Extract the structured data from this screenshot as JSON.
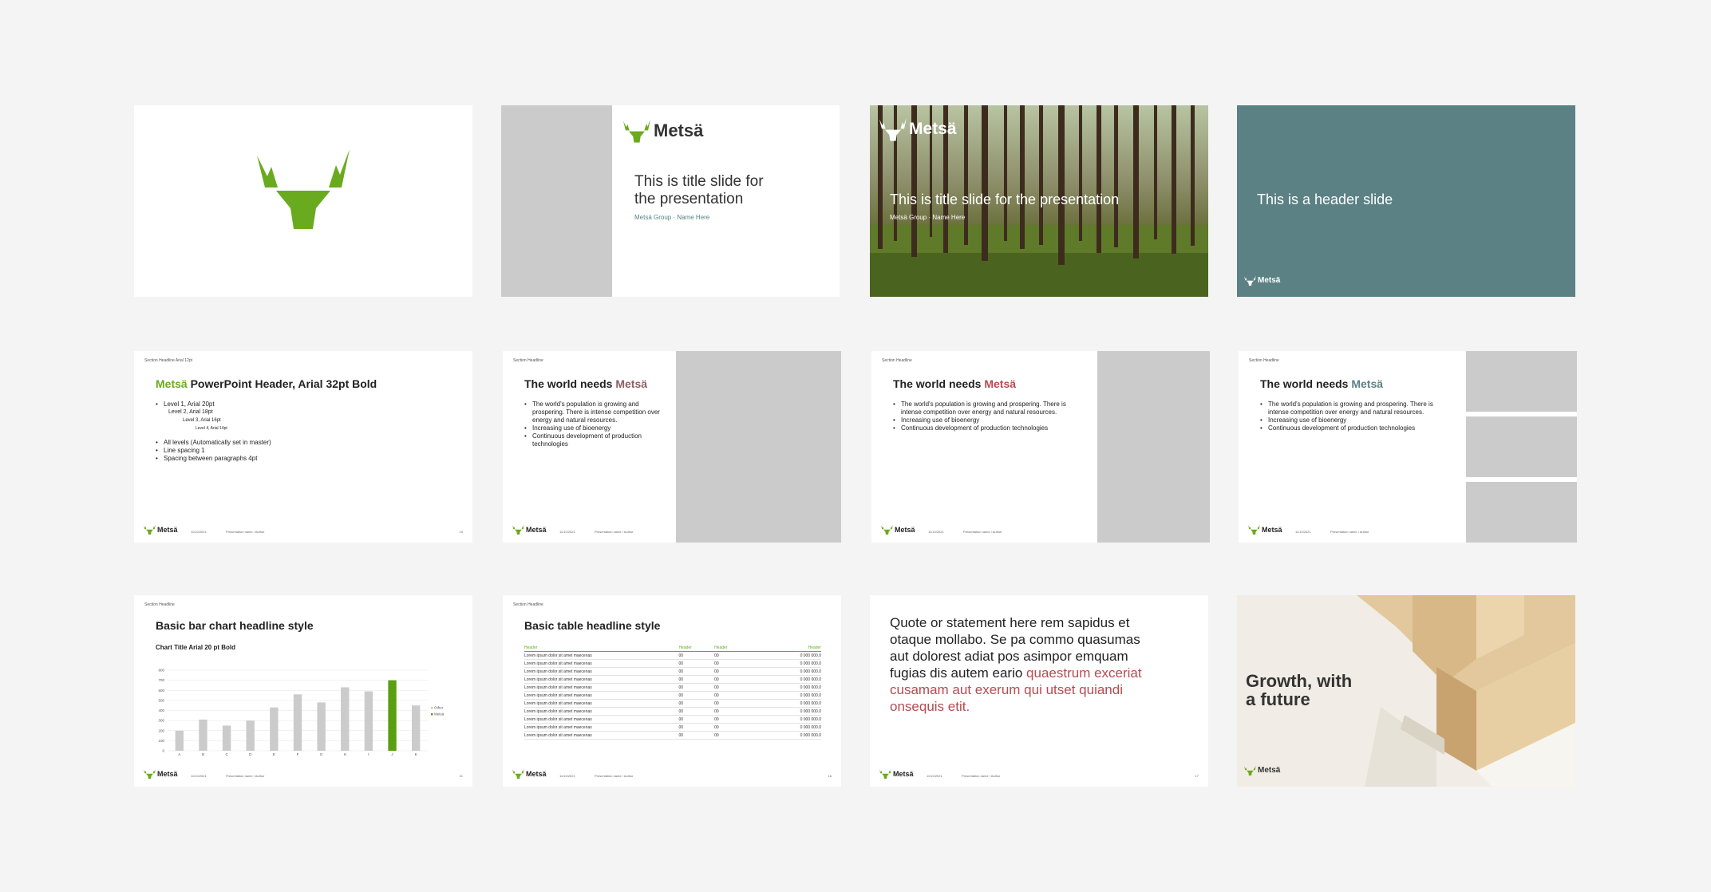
{
  "brand": {
    "name": "Metsä",
    "green": "#6aaa1e",
    "red": "#b64b50",
    "teal": "#5b8185",
    "grey": "#cbcbcb"
  },
  "footer": {
    "date": "11/10/2021",
    "presentation": "Presentation name / Author"
  },
  "slide2": {
    "title_l1": "This is title slide for",
    "title_l2": "the presentation",
    "subtitle": "Metsä Group · Name Here"
  },
  "slide3": {
    "title": "This is title slide for the presentation",
    "subtitle": "Metsä Group · Name Here"
  },
  "slide4": {
    "title": "This is a header slide"
  },
  "slide5": {
    "section": "Section Headline Arial 12pt",
    "header_brand": "Metsä",
    "header_rest": " PowerPoint Header, Arial 32pt Bold",
    "level1": "Level 1, Arial 20pt",
    "level2": "Level 2, Arial 18pt",
    "level3": "Level 3, Arial 16pt",
    "level4": "Level 4, Arial 14pt",
    "bullets": [
      "All levels (Automatically set in master)",
      "Line spacing 1",
      "Spacing between paragraphs 4pt"
    ],
    "page": "15"
  },
  "world": {
    "section": "Section Headline",
    "title_prefix": "The world needs ",
    "title_brand": "Metsä",
    "b1": "The world's population is growing and prospering. There is intense competition over energy and natural resources.",
    "b2": "Increasing use of bioenergy",
    "b3": "Continuous development of production technologies"
  },
  "slide9": {
    "section": "Section Headline",
    "title": "Basic bar chart headline style",
    "chart_title": "Chart Title Arial 20 pt Bold",
    "page": "21"
  },
  "chart_data": {
    "type": "bar",
    "title": "Chart Title Arial 20 pt Bold",
    "categories": [
      "A",
      "B",
      "C",
      "D",
      "E",
      "F",
      "G",
      "H",
      "I",
      "J",
      "K"
    ],
    "values": [
      200,
      310,
      250,
      300,
      430,
      560,
      480,
      630,
      590,
      700,
      450
    ],
    "highlight_index": 9,
    "ylim": [
      0,
      800
    ],
    "yticks": [
      0,
      100,
      200,
      300,
      400,
      500,
      600,
      700,
      800
    ],
    "series_legend": [
      "Other",
      "Metsä"
    ],
    "colors": {
      "other": "#cbcbcb",
      "highlight": "#5a9e12"
    },
    "grid": true,
    "legend_position": "right"
  },
  "slide10": {
    "section": "Section Headline",
    "title": "Basic table headline style",
    "headers": [
      "Header",
      "Header",
      "Header",
      "Header"
    ],
    "rows": [
      [
        "Lorem ipsum dolor sit amet maecenas",
        "00",
        "00",
        "0 000 000.0"
      ],
      [
        "Lorem ipsum dolor sit amet maecenas",
        "00",
        "00",
        "0 000 000.0"
      ],
      [
        "Lorem ipsum dolor sit amet maecenas",
        "00",
        "00",
        "0 000 000.0"
      ],
      [
        "Lorem ipsum dolor sit amet maecenas",
        "00",
        "00",
        "0 000 000.0"
      ],
      [
        "Lorem ipsum dolor sit amet maecenas",
        "00",
        "00",
        "0 000 000.0"
      ],
      [
        "Lorem ipsum dolor sit amet maecenas",
        "00",
        "00",
        "0 000 000.0"
      ],
      [
        "Lorem ipsum dolor sit amet maecenas",
        "00",
        "00",
        "0 000 000.0"
      ],
      [
        "Lorem ipsum dolor sit amet maecenas",
        "00",
        "00",
        "0 000 000.0"
      ],
      [
        "Lorem ipsum dolor sit amet maecenas",
        "00",
        "00",
        "0 000 000.0"
      ],
      [
        "Lorem ipsum dolor sit amet maecenas",
        "00",
        "00",
        "0 000 000.0"
      ],
      [
        "Lorem ipsum dolor sit amet maecenas",
        "00",
        "00",
        "0 000 000.0"
      ]
    ],
    "page": "16"
  },
  "slide11": {
    "quote_plain": "Quote or statement here rem sapidus et otaque mollabo. Se pa commo quasumas aut dolorest adiat pos asimpor emquam fugias dis autem eario ",
    "quote_red": "quaestrum exceriat cusamam aut exerum qui utset quiandi onsequis etit.",
    "page": "17"
  },
  "slide12": {
    "title_l1": "Growth, with",
    "title_l2": "a future"
  }
}
